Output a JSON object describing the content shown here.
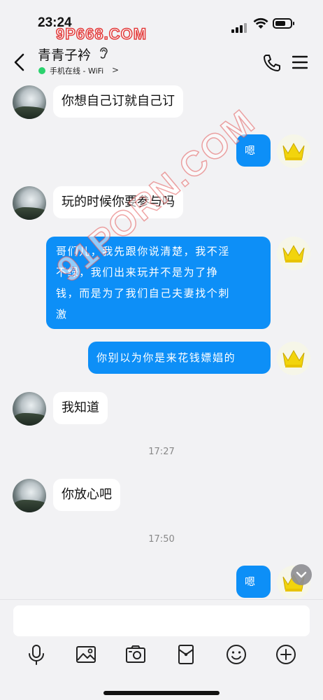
{
  "status_bar": {
    "time": "23:24"
  },
  "watermark": {
    "top": "9P668.COM",
    "diagonal": "91PORN.COM"
  },
  "header": {
    "contact_name": "青青子衿",
    "online_status": "手机在线 - WiFi",
    "online_chevron": ">"
  },
  "messages": [
    {
      "side": "left",
      "text": "你想自己订就自己订"
    },
    {
      "side": "right",
      "text": "嗯"
    },
    {
      "side": "left",
      "text": "玩的时候你要参与吗"
    },
    {
      "side": "right",
      "lines": [
        "哥们儿，我先跟你说清楚，我不淫",
        "不绿，我们出来玩并不是为了挣",
        "钱，而是为了我们自己夫妻找个刺",
        "激"
      ]
    },
    {
      "side": "right",
      "text": "你别以为你是来花钱嫖娼的"
    },
    {
      "side": "left",
      "text": "我知道"
    },
    {
      "timestamp": "17:27"
    },
    {
      "side": "left",
      "text": "你放心吧"
    },
    {
      "timestamp": "17:50"
    },
    {
      "side": "right",
      "text": "嗯"
    }
  ],
  "input": {
    "value": "",
    "placeholder": ""
  },
  "toolbar": [
    "mic-icon",
    "image-icon",
    "camera-icon",
    "red-packet-icon",
    "emoji-icon",
    "plus-icon"
  ],
  "colors": {
    "bubble_out": "#0d8ff7",
    "bubble_in": "#ffffff",
    "background": "#f2f2f4",
    "online": "#2bd26e"
  }
}
